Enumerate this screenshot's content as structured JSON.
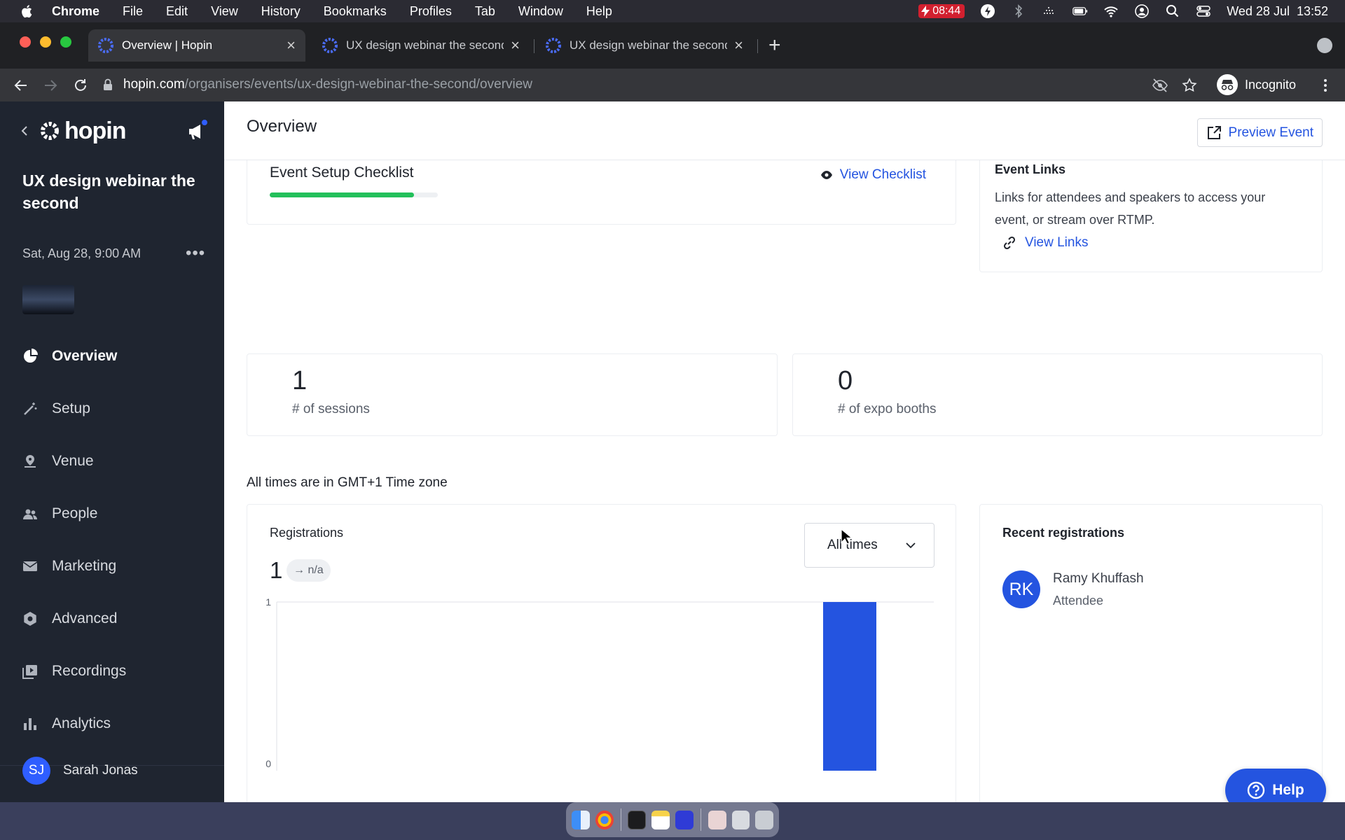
{
  "menubar": {
    "app_name": "Chrome",
    "items": [
      "File",
      "Edit",
      "View",
      "History",
      "Bookmarks",
      "Profiles",
      "Tab",
      "Window",
      "Help"
    ],
    "battery_time": "08:44",
    "datetime": "Wed 28 Jul  13:52"
  },
  "browser": {
    "tabs": [
      {
        "title": "Overview | Hopin",
        "active": true
      },
      {
        "title": "UX design webinar the second",
        "active": false
      },
      {
        "title": "UX design webinar the second",
        "active": false
      }
    ],
    "url_host": "hopin.com",
    "url_path": "/organisers/events/ux-design-webinar-the-second/overview",
    "profile_label": "Incognito"
  },
  "sidebar": {
    "logo": "hopin",
    "event_title": "UX design webinar the second",
    "event_date": "Sat, Aug 28, 9:00 AM",
    "nav": [
      {
        "label": "Overview",
        "icon": "pie-chart-icon",
        "active": true
      },
      {
        "label": "Setup",
        "icon": "magic-wand-icon"
      },
      {
        "label": "Venue",
        "icon": "venue-pin-icon"
      },
      {
        "label": "People",
        "icon": "people-icon"
      },
      {
        "label": "Marketing",
        "icon": "mail-icon"
      },
      {
        "label": "Advanced",
        "icon": "gear-icon"
      },
      {
        "label": "Recordings",
        "icon": "recordings-icon"
      },
      {
        "label": "Analytics",
        "icon": "bar-chart-icon"
      }
    ],
    "user": {
      "initials": "SJ",
      "name": "Sarah Jonas"
    }
  },
  "header": {
    "title": "Overview",
    "preview_label": "Preview Event"
  },
  "checklist": {
    "title": "Event Setup Checklist",
    "progress": 0.86,
    "link_label": "View Checklist"
  },
  "event_links": {
    "title": "Event Links",
    "description": "Links for attendees and speakers to access your event, or stream over RTMP.",
    "link_label": "View Links"
  },
  "stats": [
    {
      "value": "1",
      "label": "# of sessions"
    },
    {
      "value": "0",
      "label": "# of expo booths"
    }
  ],
  "timezone_note": "All times are in GMT+1 Time zone",
  "registrations": {
    "title": "Registrations",
    "count": "1",
    "change": "→ n/a",
    "range_selected": "All times"
  },
  "chart_data": {
    "type": "bar",
    "categories": [
      ""
    ],
    "values": [
      1
    ],
    "ylim": [
      0,
      1
    ],
    "yticks": [
      "1",
      "0"
    ],
    "title": "",
    "xlabel": "",
    "ylabel": "",
    "grid": true,
    "color": "#2454e0"
  },
  "recent": {
    "title": "Recent registrations",
    "items": [
      {
        "initials": "RK",
        "name": "Ramy Khuffash",
        "role": "Attendee"
      }
    ]
  },
  "help_label": "Help",
  "colors": {
    "accent": "#2454e0",
    "sidebar_bg": "#1f2530",
    "progress": "#22c05a"
  }
}
